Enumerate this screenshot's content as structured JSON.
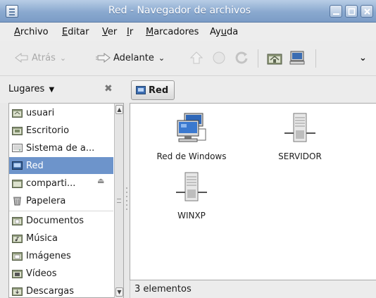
{
  "window": {
    "title": "Red - Navegador de archivos",
    "controls": [
      "minimize",
      "maximize",
      "close"
    ]
  },
  "menubar": {
    "items": [
      {
        "label": "Archivo",
        "mnemonic": "A"
      },
      {
        "label": "Editar",
        "mnemonic": "E"
      },
      {
        "label": "Ver",
        "mnemonic": "V"
      },
      {
        "label": "Ir",
        "mnemonic": "I"
      },
      {
        "label": "Marcadores",
        "mnemonic": "M"
      },
      {
        "label": "Ayuda",
        "mnemonic": "u"
      }
    ]
  },
  "toolbar": {
    "back_label": "Atrás",
    "forward_label": "Adelante",
    "back_enabled": false,
    "forward_enabled": true,
    "icons": [
      "back-icon",
      "forward-icon",
      "up-icon",
      "stop-icon",
      "reload-icon",
      "home-icon",
      "computer-icon",
      "overflow-chevron-icon"
    ]
  },
  "location": {
    "places_label": "Lugares",
    "current": "Red"
  },
  "sidebar": {
    "items": [
      {
        "label": "usuari",
        "icon": "home-folder-icon",
        "selected": false
      },
      {
        "label": "Escritorio",
        "icon": "desktop-folder-icon",
        "selected": false
      },
      {
        "label": "Sistema de a...",
        "icon": "filesystem-icon",
        "selected": false
      },
      {
        "label": "Red",
        "icon": "network-icon",
        "selected": true
      },
      {
        "label": "comparti...",
        "icon": "shared-folder-icon",
        "selected": false,
        "ejectable": true
      },
      {
        "label": "Papelera",
        "icon": "trash-icon",
        "selected": false
      },
      {
        "label": "Documentos",
        "icon": "documents-folder-icon",
        "selected": false
      },
      {
        "label": "Música",
        "icon": "music-folder-icon",
        "selected": false
      },
      {
        "label": "Imágenes",
        "icon": "pictures-folder-icon",
        "selected": false
      },
      {
        "label": "Vídeos",
        "icon": "videos-folder-icon",
        "selected": false
      },
      {
        "label": "Descargas",
        "icon": "downloads-folder-icon",
        "selected": false
      }
    ]
  },
  "content": {
    "items": [
      {
        "label": "Red de Windows",
        "icon": "windows-network-icon"
      },
      {
        "label": "SERVIDOR",
        "icon": "server-icon"
      },
      {
        "label": "WINXP",
        "icon": "server-icon"
      }
    ]
  },
  "status": {
    "text": "3 elementos"
  },
  "colors": {
    "titlebar": "#8aa9cf",
    "selection": "#6d94cb",
    "background": "#ececec"
  }
}
